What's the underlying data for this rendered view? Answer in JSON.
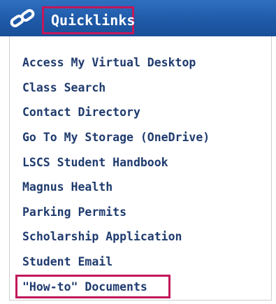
{
  "header": {
    "icon": "chain-link-icon",
    "title": "Quicklinks",
    "highlight_color": "#c2185b"
  },
  "links": [
    "Access My Virtual Desktop",
    "Class Search",
    "Contact Directory",
    "Go To My Storage (OneDrive)",
    "LSCS Student Handbook",
    "Magnus Health",
    "Parking Permits",
    "Scholarship Application",
    "Student Email",
    "\"How-to\" Documents"
  ],
  "colors": {
    "header_bg": "#1f5aa8",
    "link_text": "#1f3b6e",
    "highlight": "#c2185b"
  }
}
